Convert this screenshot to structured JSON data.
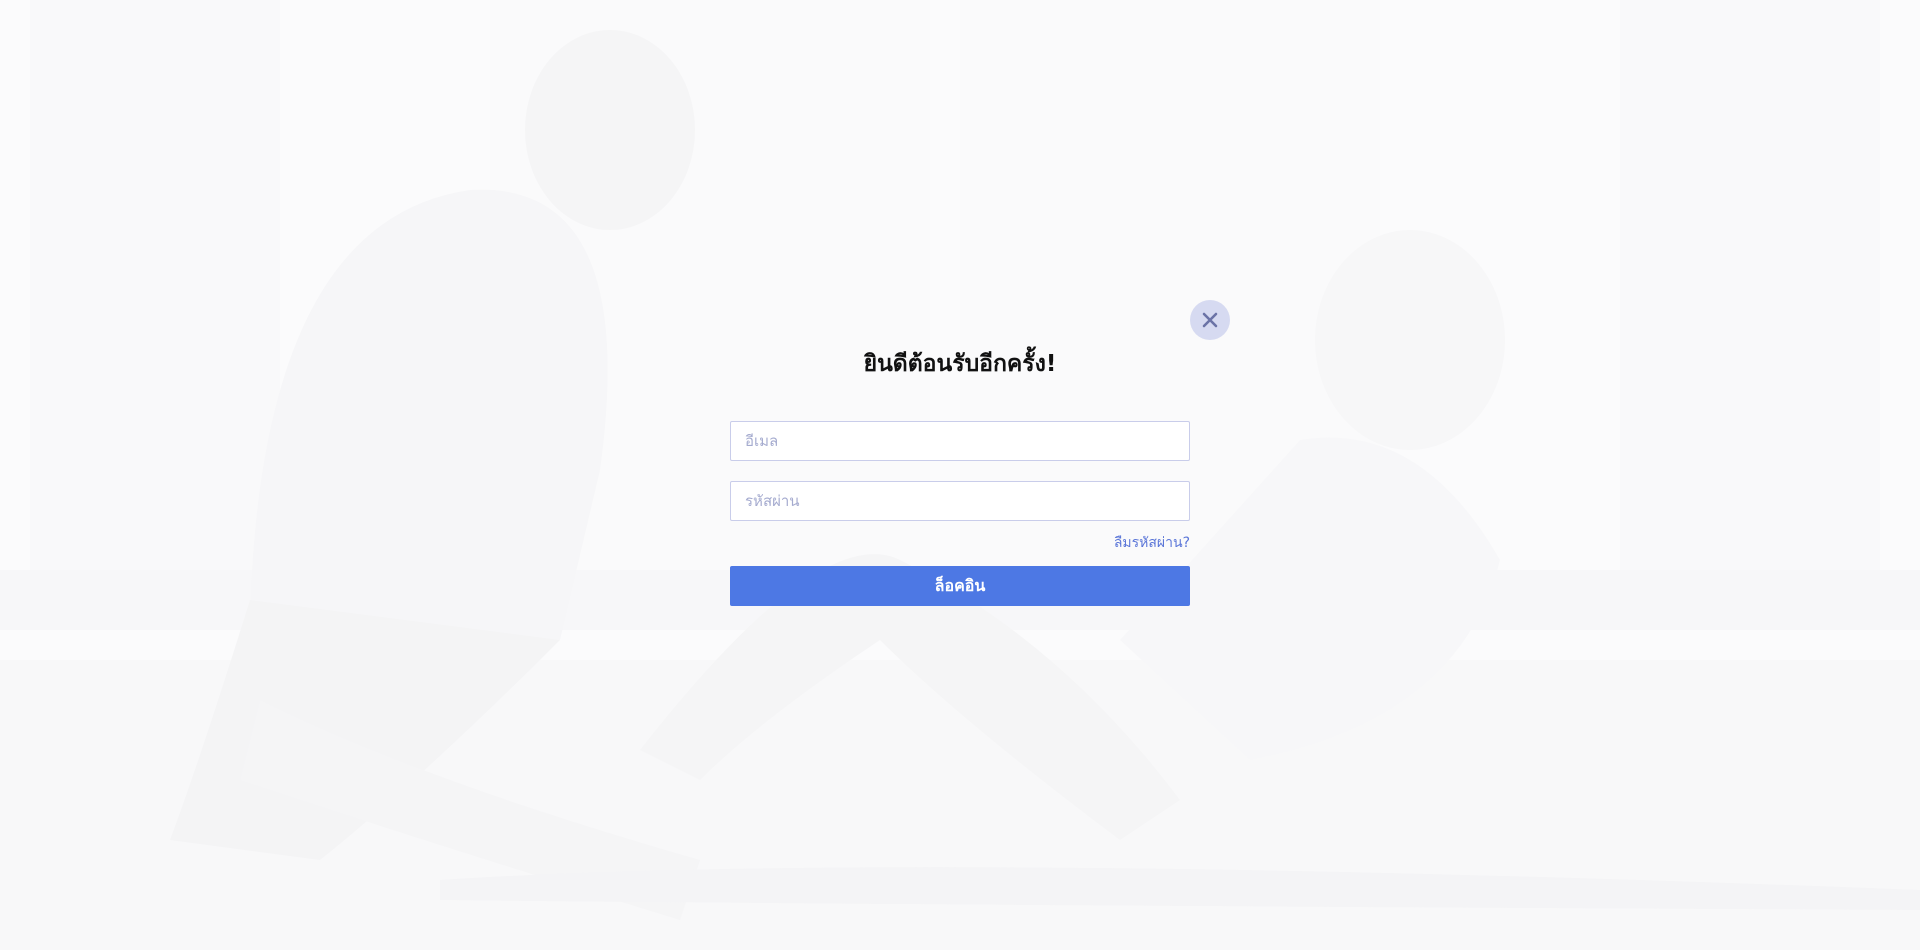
{
  "modal": {
    "title": "ยินดีต้อนรับอีกครั้ง!",
    "email_placeholder": "อีเมล",
    "password_placeholder": "รหัสผ่าน",
    "forgot_password_label": "ลืมรหัสผ่าน?",
    "login_label": "ล็อคอิน",
    "close_icon": "close-icon"
  },
  "colors": {
    "accent": "#4d78e4",
    "link": "#5b76d8",
    "close_bg": "#d6daf1",
    "field_border": "#c9cdea"
  }
}
